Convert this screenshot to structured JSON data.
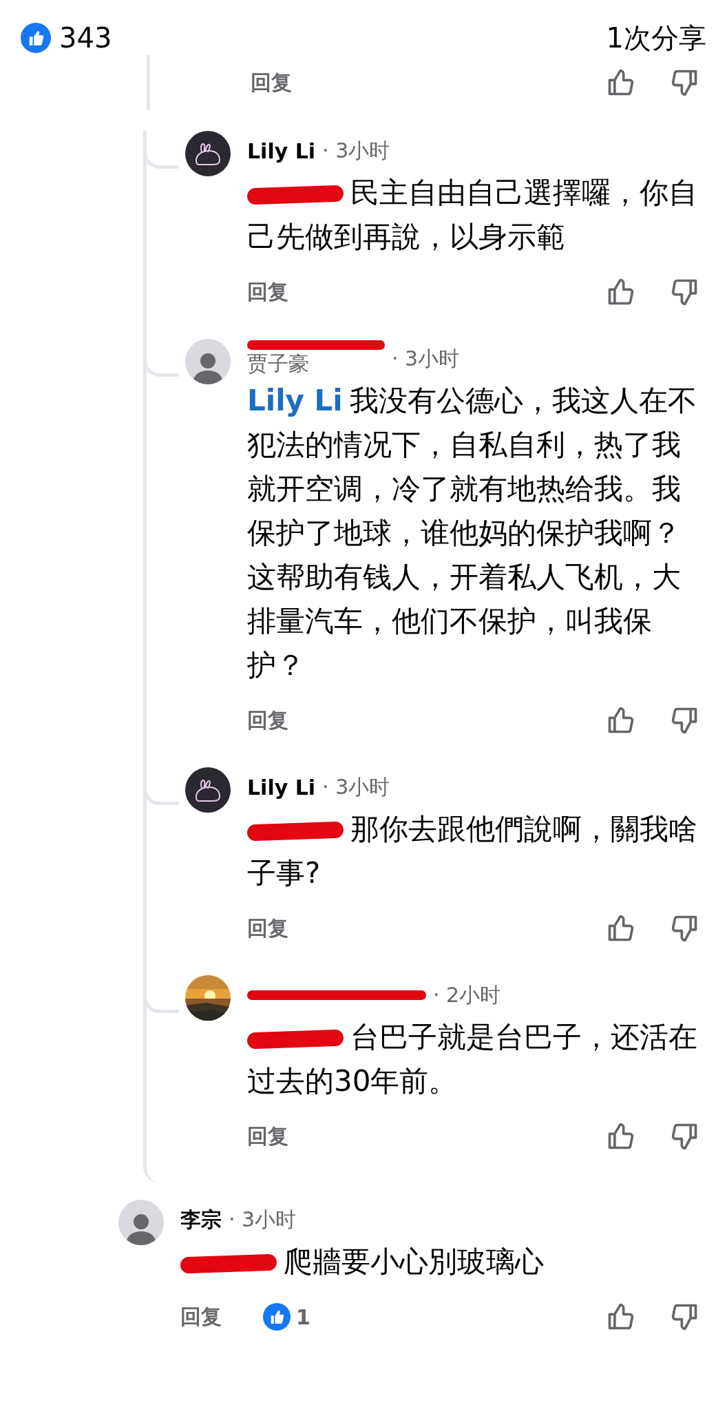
{
  "header": {
    "like_count": "343",
    "shares": "1次分享"
  },
  "previous_actions": {
    "reply": "回复"
  },
  "replies": [
    {
      "avatar": {
        "kind": "rabbit"
      },
      "author": {
        "kind": "name",
        "text": "Lily Li"
      },
      "time": "· 3小时",
      "mention": {
        "kind": "scribble"
      },
      "text": "民主自由自己選擇囉，你自己先做到再說，以身示範",
      "reply": "回复"
    },
    {
      "avatar": {
        "kind": "default"
      },
      "author": {
        "kind": "scribbled_name",
        "text": "贾子豪"
      },
      "time": "· 3小时",
      "mention": {
        "kind": "name",
        "text": "Lily Li"
      },
      "text": "我没有公德心，我这人在不犯法的情况下，自私自利，热了我就开空调，冷了就有地热给我。我保护了地球，谁他妈的保护我啊？这帮助有钱人，开着私人飞机，大排量汽车，他们不保护，叫我保护？",
      "reply": "回复"
    },
    {
      "avatar": {
        "kind": "rabbit"
      },
      "author": {
        "kind": "name",
        "text": "Lily Li"
      },
      "time": "· 3小时",
      "mention": {
        "kind": "scribble"
      },
      "text": "那你去跟他們說啊，關我啥子事?",
      "reply": "回复"
    },
    {
      "author": {
        "kind": "scribble"
      },
      "time": "· 2小时",
      "mention": {
        "kind": "scribble"
      },
      "text": "台巴子就是台巴子，还活在过去的30年前。",
      "reply": "回复"
    }
  ],
  "comment": {
    "avatar": {
      "kind": "default"
    },
    "author": {
      "kind": "name",
      "text": "李宗"
    },
    "time": "· 3小时",
    "mention": {
      "kind": "scribble"
    },
    "text": "爬牆要小心別玻璃心",
    "reply": "回复",
    "like_count": "1"
  }
}
